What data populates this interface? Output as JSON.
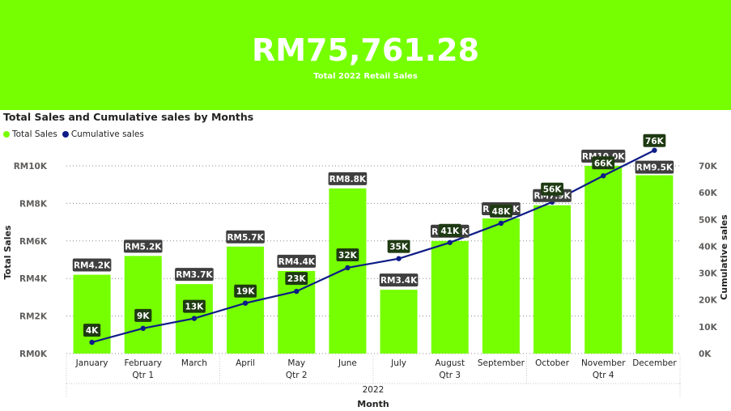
{
  "kpi": {
    "value": "RM75,761.28",
    "caption": "Total 2022 Retail Sales"
  },
  "colors": {
    "banner": "#76FF00",
    "bars": "#76FF00",
    "line": "#0E1C87",
    "bar_label_bg": "#3F3F3F",
    "line_label_bg": "#1E3A12"
  },
  "chart_data": {
    "type": "bar",
    "title": "Total Sales and Cumulative sales by Months",
    "xlabel": "Month",
    "ylabel": "Total Sales",
    "y2label": "Cumulative sales",
    "ylim": [
      0,
      10000
    ],
    "y2lim": [
      0,
      75000
    ],
    "y_ticks": [
      "RM0K",
      "RM2K",
      "RM4K",
      "RM6K",
      "RM8K",
      "RM10K"
    ],
    "y2_ticks": [
      "0K",
      "10K",
      "20K",
      "30K",
      "40K",
      "50K",
      "60K",
      "70K"
    ],
    "grid": true,
    "legend_position": "top-left",
    "categories": [
      "January",
      "February",
      "March",
      "April",
      "May",
      "June",
      "July",
      "August",
      "September",
      "October",
      "November",
      "December"
    ],
    "quarters": [
      "Qtr 1",
      "Qtr 2",
      "Qtr 3",
      "Qtr 4"
    ],
    "year": "2022",
    "series": [
      {
        "name": "Total Sales",
        "type": "bar",
        "values": [
          4200,
          5200,
          3700,
          5700,
          4400,
          8800,
          3400,
          6000,
          7200,
          7900,
          10000,
          9500
        ],
        "labels": [
          "RM4.2K",
          "RM5.2K",
          "RM3.7K",
          "RM5.7K",
          "RM4.4K",
          "RM8.8K",
          "RM3.4K",
          "RM6.0K",
          "RM7.2K",
          "RM7.9K",
          "RM10.0K",
          "RM9.5K"
        ]
      },
      {
        "name": "Cumulative sales",
        "type": "line",
        "axis": "right",
        "values": [
          4200,
          9400,
          13100,
          18800,
          23200,
          32000,
          35400,
          41400,
          48600,
          56500,
          66300,
          75800
        ],
        "labels": [
          "4K",
          "9K",
          "13K",
          "19K",
          "23K",
          "32K",
          "35K",
          "41K",
          "48K",
          "56K",
          "66K",
          "76K"
        ]
      }
    ]
  }
}
